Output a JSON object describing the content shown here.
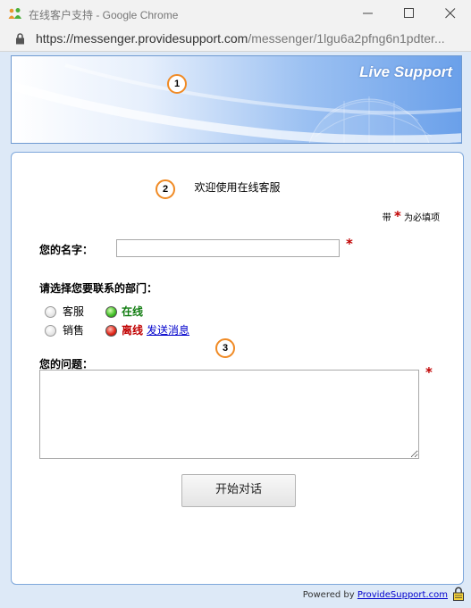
{
  "window": {
    "title": "在线客户支持 - Google Chrome",
    "url_host": "https://messenger.providesupport.com",
    "url_path": "/messenger/1lgu6a2pfng6n1pdter..."
  },
  "banner": {
    "title": "Live Support"
  },
  "markers": [
    "1",
    "2",
    "3"
  ],
  "form": {
    "welcome": "欢迎使用在线客服",
    "required_prefix": "带",
    "required_star": "*",
    "required_suffix": "为必填项",
    "name_label": "您的名字：",
    "name_value": "",
    "dept_label": "请选择您要联系的部门：",
    "departments": [
      {
        "name": "客服",
        "status": "在线",
        "status_color": "#127d12",
        "selected": false
      },
      {
        "name": "销售",
        "status": "离线",
        "status_color": "#c00000",
        "selected": false,
        "link": "发送消息"
      }
    ],
    "question_label": "您的问题：",
    "question_value": "",
    "start_button": "开始对话"
  },
  "footer": {
    "powered_by": "Powered by",
    "link": "ProvideSupport.com"
  },
  "colors": {
    "accent": "#6aa0ea",
    "required": "#c00000",
    "online": "#127d12",
    "offline": "#c00000",
    "marker": "#f08a24"
  }
}
